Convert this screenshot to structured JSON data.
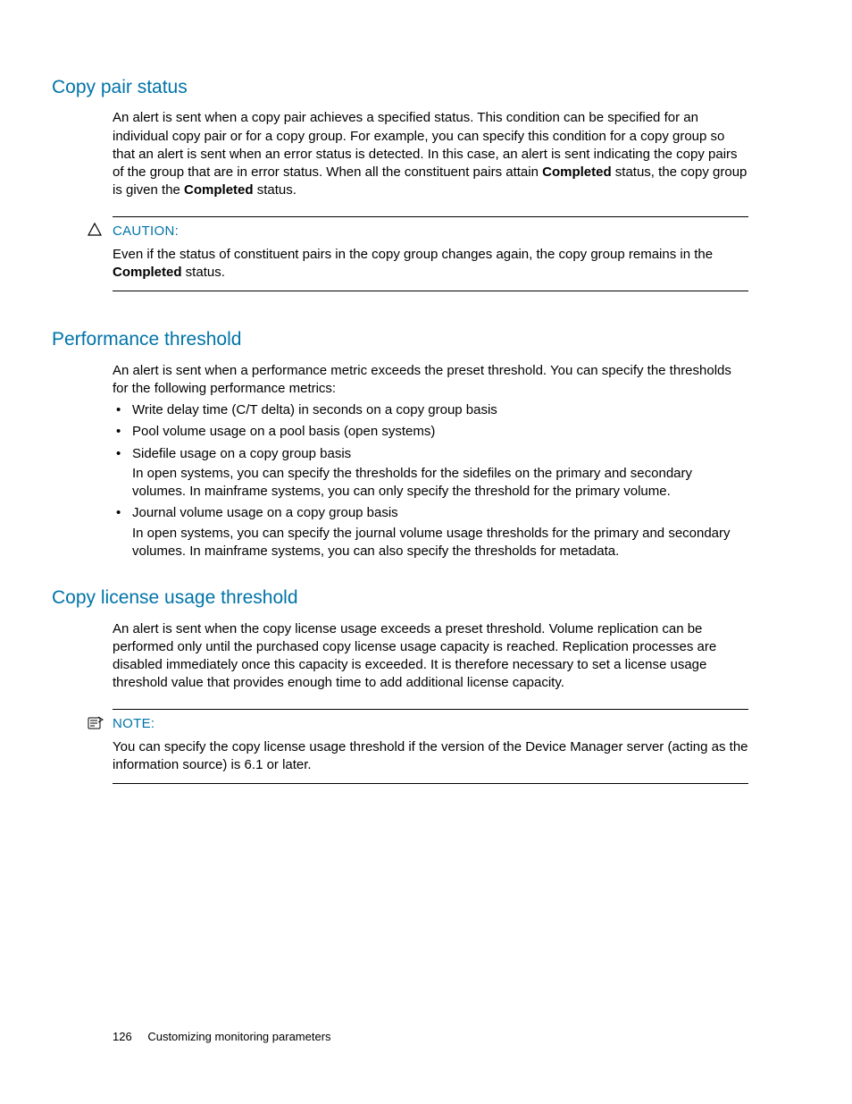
{
  "sections": {
    "copyPair": {
      "heading": "Copy pair status",
      "para_before_bold1": "An alert is sent when a copy pair achieves a specified status. This condition can be specified for an individual copy pair or for a copy group. For example, you can specify this condition for a copy group so that an alert is sent when an error status is detected. In this case, an alert is sent indicating the copy pairs of the group that are in error status. When all the constituent pairs attain ",
      "bold1": "Completed",
      "para_mid": " status, the copy group is given the ",
      "bold2": "Completed",
      "para_after_bold2": " status."
    },
    "caution": {
      "label": "CAUTION:",
      "text_before_bold": "Even if the status of constituent pairs in the copy group changes again, the copy group remains in the ",
      "bold": "Completed",
      "text_after_bold": " status."
    },
    "perf": {
      "heading": "Performance threshold",
      "intro": "An alert is sent when a performance metric exceeds the preset threshold. You can specify the thresholds for the following performance metrics:",
      "bullets": [
        {
          "head": "Write delay time (C/T delta) in seconds on a copy group basis",
          "body": ""
        },
        {
          "head": "Pool volume usage on a pool basis (open systems)",
          "body": ""
        },
        {
          "head": "Sidefile usage on a copy group basis",
          "body": "In open systems, you can specify the thresholds for the sidefiles on the primary and secondary volumes. In mainframe systems, you can only specify the threshold for the primary volume."
        },
        {
          "head": "Journal volume usage on a copy group basis",
          "body": "In open systems, you can specify the journal volume usage thresholds for the primary and secondary volumes. In mainframe systems, you can also specify the thresholds for metadata."
        }
      ]
    },
    "license": {
      "heading": "Copy license usage threshold",
      "para": "An alert is sent when the copy license usage exceeds a preset threshold. Volume replication can be performed only until the purchased copy license usage capacity is reached. Replication processes are disabled immediately once this capacity is exceeded. It is therefore necessary to set a license usage threshold value that provides enough time to add additional license capacity."
    },
    "note": {
      "label": "NOTE:",
      "text": "You can specify the copy license usage threshold if the version of the Device Manager server (acting as the information source) is 6.1 or later."
    }
  },
  "footer": {
    "pageNumber": "126",
    "chapter": "Customizing monitoring parameters"
  }
}
